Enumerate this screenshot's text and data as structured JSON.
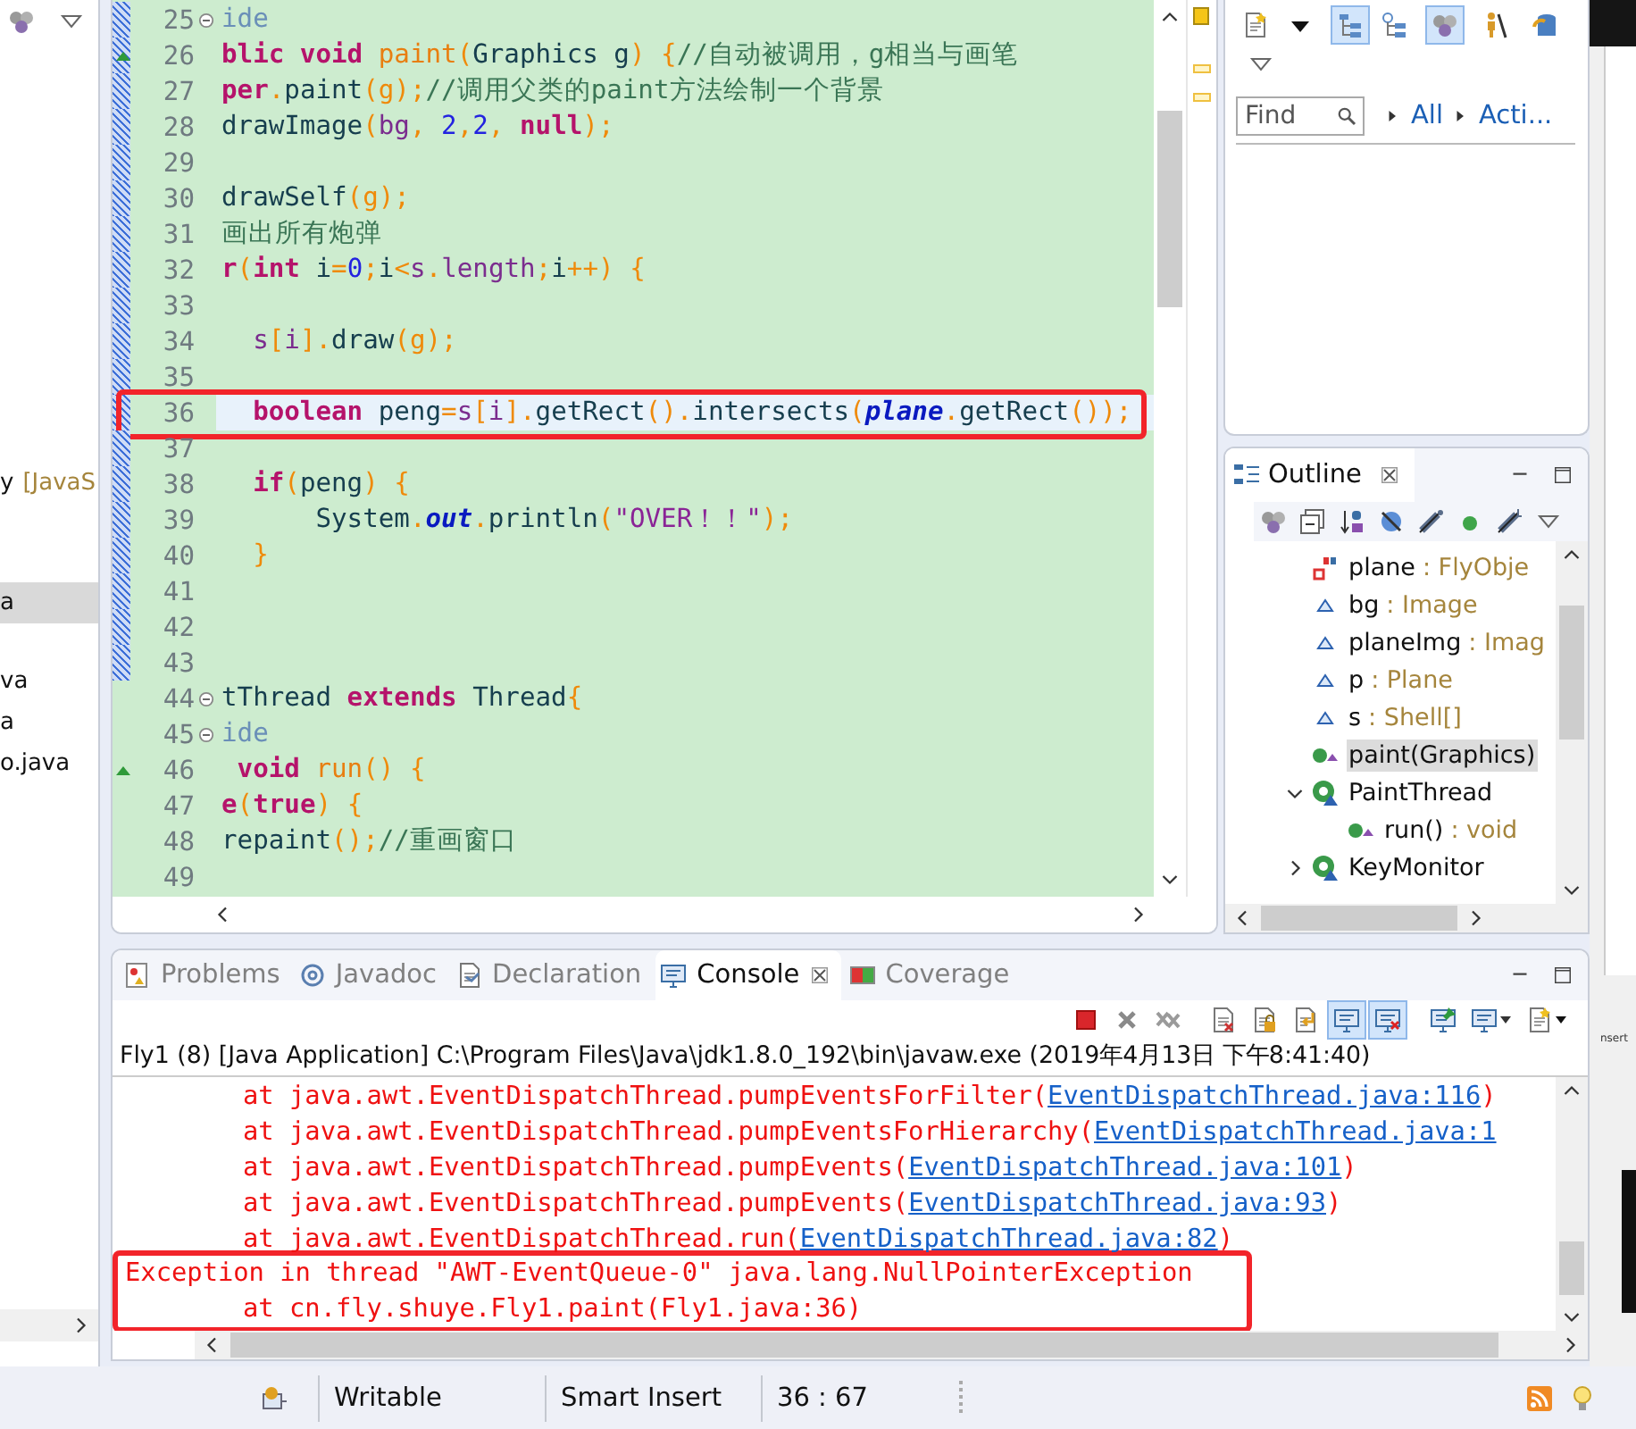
{
  "package_explorer": {
    "items": [
      {
        "label": "y",
        "decoration": "[JavaS",
        "selected": false
      },
      {
        "label": "a",
        "selected": true
      },
      {
        "label": "va",
        "selected": false
      },
      {
        "label": "a",
        "selected": false
      },
      {
        "label": "o.java",
        "selected": false
      }
    ]
  },
  "editor": {
    "lines": [
      {
        "n": "25",
        "changed": true,
        "override": false,
        "fold": true,
        "current": false,
        "boxed": false,
        "tokens": [
          {
            "text": "ide",
            "kind": "annotation"
          }
        ]
      },
      {
        "n": "26",
        "changed": true,
        "override": true,
        "fold": false,
        "current": false,
        "boxed": false,
        "tokens": [
          {
            "text": "blic void ",
            "kind": "keyword"
          },
          {
            "text": "paint",
            "kind": "method"
          },
          {
            "text": "(",
            "kind": "punct"
          },
          {
            "text": "Graphics g",
            "kind": "plain"
          },
          {
            "text": ") {",
            "kind": "punct"
          },
          {
            "text": "//自动被调用，g相当与画笔",
            "kind": "comment"
          }
        ]
      },
      {
        "n": "27",
        "changed": true,
        "override": false,
        "fold": false,
        "current": false,
        "boxed": false,
        "tokens": [
          {
            "text": "per",
            "kind": "keyword"
          },
          {
            "text": ".",
            "kind": "punct"
          },
          {
            "text": "paint",
            "kind": "plain"
          },
          {
            "text": "(g);",
            "kind": "punct"
          },
          {
            "text": "//调用父类的paint方法绘制一个背景",
            "kind": "comment"
          }
        ]
      },
      {
        "n": "28",
        "changed": true,
        "override": false,
        "fold": false,
        "current": false,
        "boxed": false,
        "tokens": [
          {
            "text": "drawImage",
            "kind": "plain"
          },
          {
            "text": "(",
            "kind": "punct"
          },
          {
            "text": "bg",
            "kind": "var"
          },
          {
            "text": ", ",
            "kind": "punct"
          },
          {
            "text": "2",
            "kind": "number"
          },
          {
            "text": ",",
            "kind": "punct"
          },
          {
            "text": "2",
            "kind": "number"
          },
          {
            "text": ", ",
            "kind": "punct"
          },
          {
            "text": "null",
            "kind": "keyword"
          },
          {
            "text": ");",
            "kind": "punct"
          }
        ]
      },
      {
        "n": "29",
        "changed": true,
        "override": false,
        "fold": false,
        "current": false,
        "boxed": false
      },
      {
        "n": "30",
        "changed": true,
        "override": false,
        "fold": false,
        "current": false,
        "boxed": false,
        "tokens": [
          {
            "text": "drawSelf",
            "kind": "plain"
          },
          {
            "text": "(g);",
            "kind": "punct"
          }
        ]
      },
      {
        "n": "31",
        "changed": true,
        "override": false,
        "fold": false,
        "current": false,
        "boxed": false,
        "tokens": [
          {
            "text": "画出所有炮弹",
            "kind": "comment"
          }
        ]
      },
      {
        "n": "32",
        "changed": true,
        "override": false,
        "fold": false,
        "current": false,
        "boxed": false,
        "tokens": [
          {
            "text": "r",
            "kind": "keyword"
          },
          {
            "text": "(",
            "kind": "punct"
          },
          {
            "text": "int",
            "kind": "keyword"
          },
          {
            "text": " i",
            "kind": "plain"
          },
          {
            "text": "=",
            "kind": "punct"
          },
          {
            "text": "0",
            "kind": "number"
          },
          {
            "text": ";",
            "kind": "punct"
          },
          {
            "text": "i",
            "kind": "plain"
          },
          {
            "text": "<",
            "kind": "punct"
          },
          {
            "text": "s",
            "kind": "var"
          },
          {
            "text": ".",
            "kind": "punct"
          },
          {
            "text": "length",
            "kind": "var"
          },
          {
            "text": ";",
            "kind": "punct"
          },
          {
            "text": "i",
            "kind": "plain"
          },
          {
            "text": "++) {",
            "kind": "punct"
          }
        ]
      },
      {
        "n": "33",
        "changed": true,
        "override": false,
        "fold": false,
        "current": false,
        "boxed": false
      },
      {
        "n": "34",
        "changed": true,
        "override": false,
        "fold": false,
        "current": false,
        "boxed": false,
        "tokens": [
          {
            "text": "  s",
            "kind": "var"
          },
          {
            "text": "[",
            "kind": "punct"
          },
          {
            "text": "i",
            "kind": "var"
          },
          {
            "text": "].",
            "kind": "punct"
          },
          {
            "text": "draw",
            "kind": "plain"
          },
          {
            "text": "(g);",
            "kind": "punct"
          }
        ]
      },
      {
        "n": "35",
        "changed": true,
        "override": false,
        "fold": false,
        "current": false,
        "boxed": false
      },
      {
        "n": "36",
        "changed": true,
        "override": false,
        "fold": false,
        "current": true,
        "boxed": true,
        "tokens": [
          {
            "text": "  boolean",
            "kind": "keyword"
          },
          {
            "text": " peng",
            "kind": "plain"
          },
          {
            "text": "=",
            "kind": "punct"
          },
          {
            "text": "s",
            "kind": "var"
          },
          {
            "text": "[",
            "kind": "punct"
          },
          {
            "text": "i",
            "kind": "var"
          },
          {
            "text": "].",
            "kind": "punct"
          },
          {
            "text": "getRect",
            "kind": "plain"
          },
          {
            "text": "().",
            "kind": "punct"
          },
          {
            "text": "intersects",
            "kind": "plain"
          },
          {
            "text": "(",
            "kind": "punct"
          },
          {
            "text": "plane",
            "kind": "field"
          },
          {
            "text": ".",
            "kind": "punct"
          },
          {
            "text": "getRect",
            "kind": "plain"
          },
          {
            "text": "());",
            "kind": "punct"
          }
        ]
      },
      {
        "n": "37",
        "changed": true,
        "override": false,
        "fold": false,
        "current": false,
        "boxed": false
      },
      {
        "n": "38",
        "changed": true,
        "override": false,
        "fold": false,
        "current": false,
        "boxed": false,
        "tokens": [
          {
            "text": "  if",
            "kind": "keyword"
          },
          {
            "text": "(",
            "kind": "punct"
          },
          {
            "text": "peng",
            "kind": "plain"
          },
          {
            "text": ") {",
            "kind": "punct"
          }
        ]
      },
      {
        "n": "39",
        "changed": true,
        "override": false,
        "fold": false,
        "current": false,
        "boxed": false,
        "tokens": [
          {
            "text": "      System",
            "kind": "plain"
          },
          {
            "text": ".",
            "kind": "punct"
          },
          {
            "text": "out",
            "kind": "field"
          },
          {
            "text": ".",
            "kind": "punct"
          },
          {
            "text": "println",
            "kind": "plain"
          },
          {
            "text": "(",
            "kind": "punct"
          },
          {
            "text": "\"OVER！！\"",
            "kind": "string"
          },
          {
            "text": ");",
            "kind": "punct"
          }
        ]
      },
      {
        "n": "40",
        "changed": true,
        "override": false,
        "fold": false,
        "current": false,
        "boxed": false,
        "tokens": [
          {
            "text": "  }",
            "kind": "punct"
          }
        ]
      },
      {
        "n": "41",
        "changed": true,
        "override": false,
        "fold": false,
        "current": false,
        "boxed": false
      },
      {
        "n": "42",
        "changed": true,
        "override": false,
        "fold": false,
        "current": false,
        "boxed": false
      },
      {
        "n": "43",
        "changed": true,
        "override": false,
        "fold": false,
        "current": false,
        "boxed": false
      },
      {
        "n": "44",
        "changed": false,
        "override": false,
        "fold": true,
        "current": false,
        "boxed": false,
        "tokens": [
          {
            "text": "tThread",
            "kind": "plain"
          },
          {
            "text": " extends",
            "kind": "keyword"
          },
          {
            "text": " Thread",
            "kind": "plain"
          },
          {
            "text": "{",
            "kind": "punct"
          }
        ]
      },
      {
        "n": "45",
        "changed": false,
        "override": false,
        "fold": true,
        "current": false,
        "boxed": false,
        "tokens": [
          {
            "text": "ide",
            "kind": "annotation"
          }
        ]
      },
      {
        "n": "46",
        "changed": false,
        "override": true,
        "fold": false,
        "current": false,
        "boxed": false,
        "tokens": [
          {
            "text": " void",
            "kind": "keyword"
          },
          {
            "text": " run",
            "kind": "method"
          },
          {
            "text": "() {",
            "kind": "punct"
          }
        ]
      },
      {
        "n": "47",
        "changed": false,
        "override": false,
        "fold": false,
        "current": false,
        "boxed": false,
        "tokens": [
          {
            "text": "e",
            "kind": "keyword"
          },
          {
            "text": "(",
            "kind": "punct"
          },
          {
            "text": "true",
            "kind": "keyword"
          },
          {
            "text": ") {",
            "kind": "punct"
          }
        ]
      },
      {
        "n": "48",
        "changed": false,
        "override": false,
        "fold": false,
        "current": false,
        "boxed": false,
        "tokens": [
          {
            "text": "repaint",
            "kind": "plain"
          },
          {
            "text": "();",
            "kind": "punct"
          },
          {
            "text": "//重画窗口",
            "kind": "comment"
          }
        ]
      },
      {
        "n": "49",
        "changed": false,
        "override": false,
        "fold": false,
        "current": false,
        "boxed": false
      }
    ]
  },
  "task_list": {
    "toolbar": [
      {
        "selected": false
      },
      {
        "selected": false
      },
      {
        "selected": true
      },
      {
        "selected": false
      },
      {
        "selected": true
      },
      {
        "selected": false
      },
      {
        "selected": false
      }
    ],
    "find": {
      "placeholder": "Find"
    },
    "filters": [
      "All",
      "Acti..."
    ]
  },
  "outline": {
    "title": "Outline",
    "items": [
      {
        "name": "plane",
        "type": ": FlyObje",
        "kind": "static-final-field",
        "selected": false
      },
      {
        "name": "bg",
        "type": ": Image",
        "kind": "field",
        "selected": false
      },
      {
        "name": "planeImg",
        "type": ": Imag",
        "kind": "field",
        "selected": false
      },
      {
        "name": "p",
        "type": ": Plane",
        "kind": "field",
        "selected": false
      },
      {
        "name": "s",
        "type": ": Shell[]",
        "kind": "field",
        "selected": false
      },
      {
        "name": "paint(Graphics)",
        "kind": "method",
        "selected": true
      },
      {
        "name": "PaintThread",
        "kind": "class",
        "expanded": true,
        "selected": false,
        "children": [
          {
            "name": "run()",
            "type": ": void",
            "kind": "method",
            "selected": false
          }
        ]
      },
      {
        "name": "KeyMonitor",
        "kind": "class",
        "expanded": false,
        "selected": false
      }
    ]
  },
  "console": {
    "tabs": [
      {
        "label": "Problems",
        "selected": false
      },
      {
        "label": "Javadoc",
        "selected": false
      },
      {
        "label": "Declaration",
        "selected": false
      },
      {
        "label": "Console",
        "selected": true
      },
      {
        "label": "Coverage",
        "selected": false
      }
    ],
    "toolbar": [
      {
        "selected": false
      },
      {
        "selected": false
      },
      {
        "selected": false
      },
      {
        "selected": false
      },
      {
        "selected": false
      },
      {
        "selected": false
      },
      {
        "selected": true
      },
      {
        "selected": true
      },
      {
        "selected": false
      },
      {
        "selected": false
      },
      {
        "selected": false
      }
    ],
    "header": "Fly1 (8) [Java Application] C:\\Program Files\\Java\\jdk1.8.0_192\\bin\\javaw.exe (2019年4月13日 下午8:41:40)",
    "lines": [
      {
        "kind": "frame",
        "text": "at java.awt.EventDispatchThread.pumpEventsForFilter(",
        "link": "EventDispatchThread.java:116",
        "tail": ")",
        "boxed": false
      },
      {
        "kind": "frame",
        "text": "at java.awt.EventDispatchThread.pumpEventsForHierarchy(",
        "link": "EventDispatchThread.java:1",
        "boxed": false
      },
      {
        "kind": "frame",
        "text": "at java.awt.EventDispatchThread.pumpEvents(",
        "link": "EventDispatchThread.java:101",
        "tail": ")",
        "boxed": false
      },
      {
        "kind": "frame",
        "text": "at java.awt.EventDispatchThread.pumpEvents(",
        "link": "EventDispatchThread.java:93",
        "tail": ")",
        "boxed": false
      },
      {
        "kind": "frame",
        "text": "at java.awt.EventDispatchThread.run(",
        "link": "EventDispatchThread.java:82",
        "tail": ")",
        "boxed": false
      },
      {
        "kind": "exception",
        "text": "Exception in thread \"AWT-EventQueue-0\" java.lang.NullPointerException",
        "boxed": true
      },
      {
        "kind": "frame",
        "text": "at cn.fly.shuye.Fly1.paint(Fly1.java:36)",
        "boxed": true
      }
    ]
  },
  "status_bar": {
    "fields": [
      "Writable",
      "Smart Insert",
      "36 : 67"
    ]
  },
  "background_window": {
    "status_text": "nsert"
  }
}
